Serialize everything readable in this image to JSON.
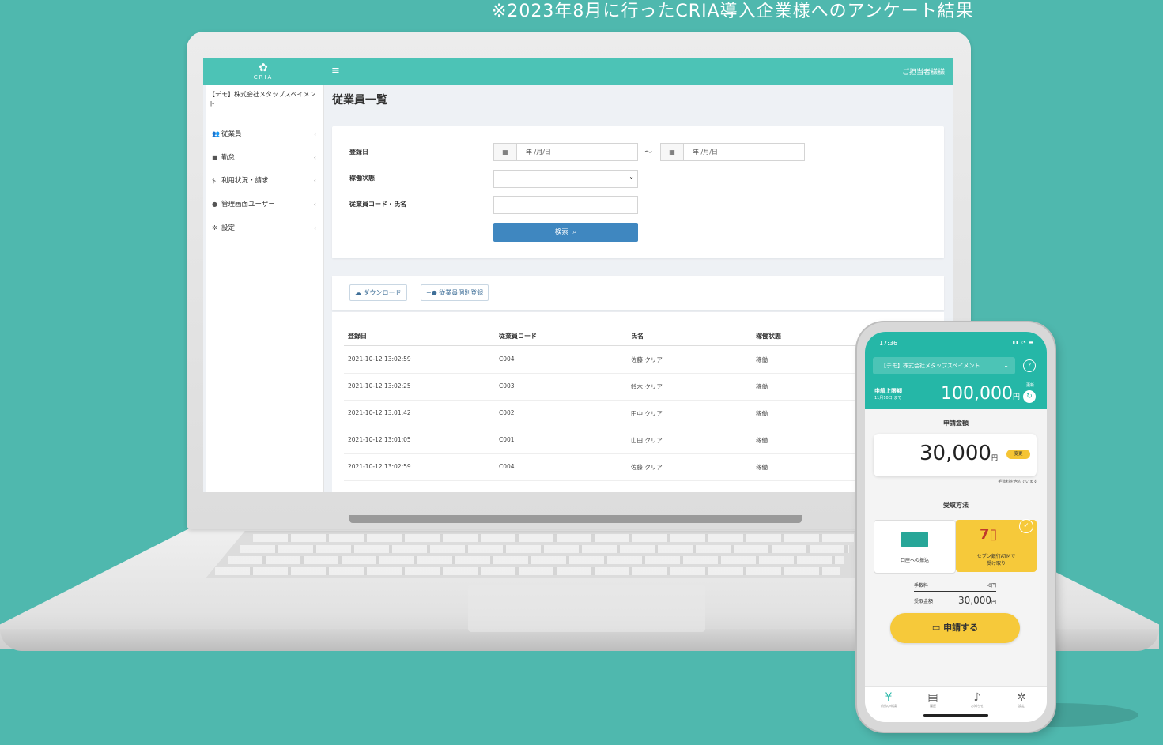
{
  "caption": "※2023年8月に行ったCRIA導入企業様へのアンケート結果",
  "admin": {
    "logo_text": "CRIA",
    "menu_icon": "≡",
    "user_label": "ご担当者様様",
    "company": "【デモ】株式会社メタップスペイメント",
    "sidebar": [
      {
        "label": "従業員",
        "icon": "users-icon"
      },
      {
        "label": "勤怠",
        "icon": "briefcase-icon"
      },
      {
        "label": "利用状況・請求",
        "icon": "dollar-icon"
      },
      {
        "label": "管理画面ユーザー",
        "icon": "user-icon"
      },
      {
        "label": "設定",
        "icon": "gear-icon"
      }
    ],
    "page_title": "従業員一覧",
    "form": {
      "date_label": "登録日",
      "date_placeholder": "年 /月/日",
      "tilde": "〜",
      "status_label": "稼働状態",
      "code_label": "従業員コード・氏名",
      "search_button": "検索"
    },
    "toolbar": {
      "download": "ダウンロード",
      "register": "従業員個別登録"
    },
    "table": {
      "columns": [
        "登録日",
        "従業員コード",
        "氏名",
        "稼働状態"
      ],
      "rows": [
        [
          "2021-10-12 13:02:59",
          "C004",
          "佐藤 クリア",
          "稼働"
        ],
        [
          "2021-10-12 13:02:25",
          "C003",
          "鈴木 クリア",
          "稼働"
        ],
        [
          "2021-10-12 13:01:42",
          "C002",
          "田中 クリア",
          "稼働"
        ],
        [
          "2021-10-12 13:01:05",
          "C001",
          "山田 クリア",
          "稼働"
        ],
        [
          "2021-10-12 13:02:59",
          "C004",
          "佐藤 クリア",
          "稼働"
        ]
      ]
    }
  },
  "phone": {
    "time": "17:36",
    "company": "【デモ】株式会社メタップスペイメント",
    "limit_label": "申請上限額",
    "limit_sub": "11月10日 まで",
    "limit_value": "100,000",
    "yen": "円",
    "refresh_label": "更新",
    "request_label": "申請金額",
    "amount": "30,000",
    "change": "変更",
    "fee_note": "手数料を含んでいます",
    "receive_label": "受取方法",
    "option_bank": "口座への振込",
    "option_atm_line1": "セブン銀行ATMで",
    "option_atm_line2": "受け取り",
    "fee_label": "手数料",
    "fee_value": "-0円",
    "total_label": "受取金額",
    "total_value": "30,000",
    "apply": "申請する",
    "nav": [
      {
        "label": "前払い申請",
        "icon": "yen-icon"
      },
      {
        "label": "履歴",
        "icon": "document-icon"
      },
      {
        "label": "お知らせ",
        "icon": "bell-icon"
      },
      {
        "label": "設定",
        "icon": "gear-icon"
      }
    ]
  }
}
